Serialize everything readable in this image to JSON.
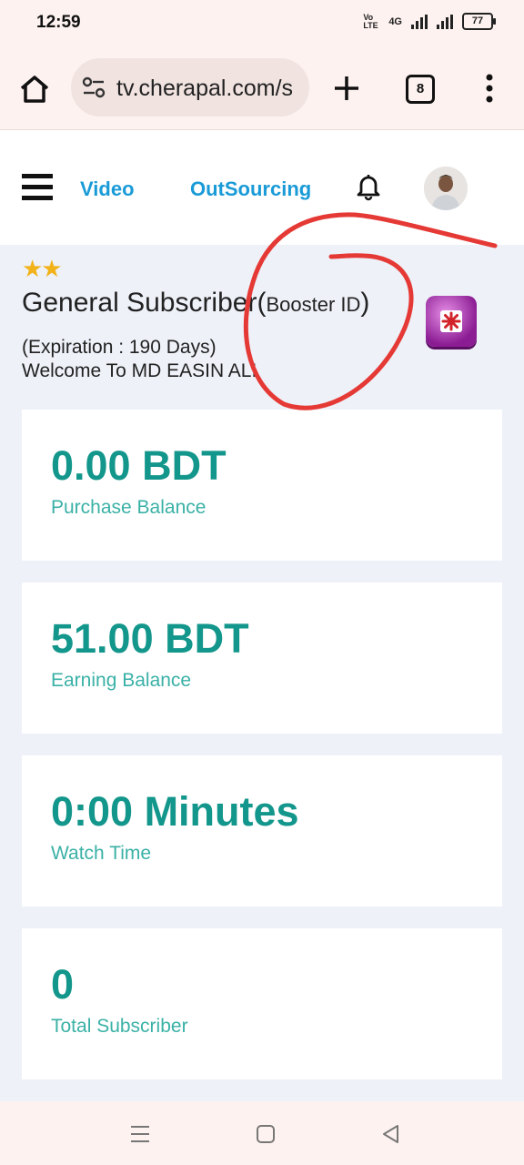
{
  "status_bar": {
    "time": "12:59",
    "network": "4G",
    "volte": "Vo LTE",
    "battery": "77"
  },
  "browser": {
    "url": "tv.cherapal.com/s",
    "tab_count": "8",
    "icons": [
      "home-icon",
      "tune-icon",
      "plus-icon",
      "tabs-icon",
      "more-vert-icon"
    ]
  },
  "navbar": {
    "video_label": "Video",
    "outsourcing_label": "OutSourcing",
    "icons": [
      "hamburger-icon",
      "bell-icon",
      "avatar"
    ]
  },
  "profile": {
    "stars": "★★",
    "title": "General Subscriber(",
    "title_small": "Booster ID",
    "title_end": ")",
    "expiration": "(Expiration : 190 Days)",
    "welcome": "Welcome To MD EASIN ALI"
  },
  "cards": [
    {
      "value": "0.00 BDT",
      "label": "Purchase Balance"
    },
    {
      "value": "51.00 BDT",
      "label": "Earning Balance"
    },
    {
      "value": "0:00 Minutes",
      "label": "Watch Time"
    },
    {
      "value": "0",
      "label": "Total Subscriber"
    }
  ],
  "colors": {
    "accent_teal": "#13968b",
    "nav_blue": "#1a9bd7",
    "annotation_red": "#e53935",
    "badge_purple": "#a22fae"
  }
}
